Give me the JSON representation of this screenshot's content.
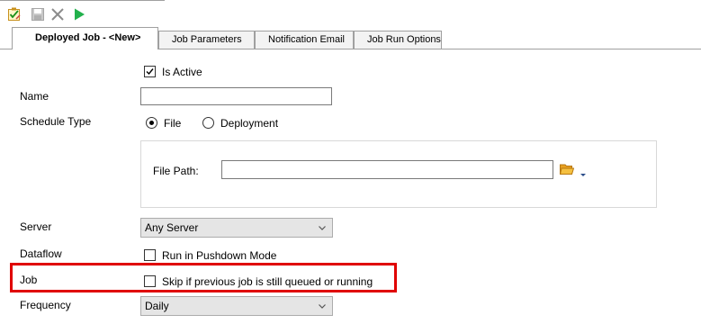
{
  "toolbar": {
    "icons": [
      "edit-checklist-icon",
      "save-icon",
      "close-icon",
      "run-icon"
    ],
    "accent": "#22b14c"
  },
  "tabs": [
    {
      "label": "Deployed Job - <New>",
      "active": true
    },
    {
      "label": "Job Parameters",
      "active": false
    },
    {
      "label": "Notification Email",
      "active": false
    },
    {
      "label": "Job Run Options",
      "active": false
    }
  ],
  "form": {
    "is_active": {
      "label": "Is Active",
      "checked": true
    },
    "name": {
      "label": "Name",
      "value": ""
    },
    "schedule_type": {
      "label": "Schedule Type",
      "options": [
        "File",
        "Deployment"
      ],
      "selected": "File"
    },
    "file_path": {
      "label": "File Path:",
      "value": ""
    },
    "server": {
      "label": "Server",
      "value": "Any Server"
    },
    "dataflow": {
      "label": "Dataflow",
      "checkbox_label": "Run in Pushdown Mode",
      "checked": false
    },
    "job": {
      "label": "Job",
      "checkbox_label": "Skip if previous job is still queued or running",
      "checked": false
    },
    "frequency": {
      "label": "Frequency",
      "value": "Daily"
    }
  },
  "colors": {
    "highlight": "#e00000",
    "folder": "#f0b429"
  }
}
